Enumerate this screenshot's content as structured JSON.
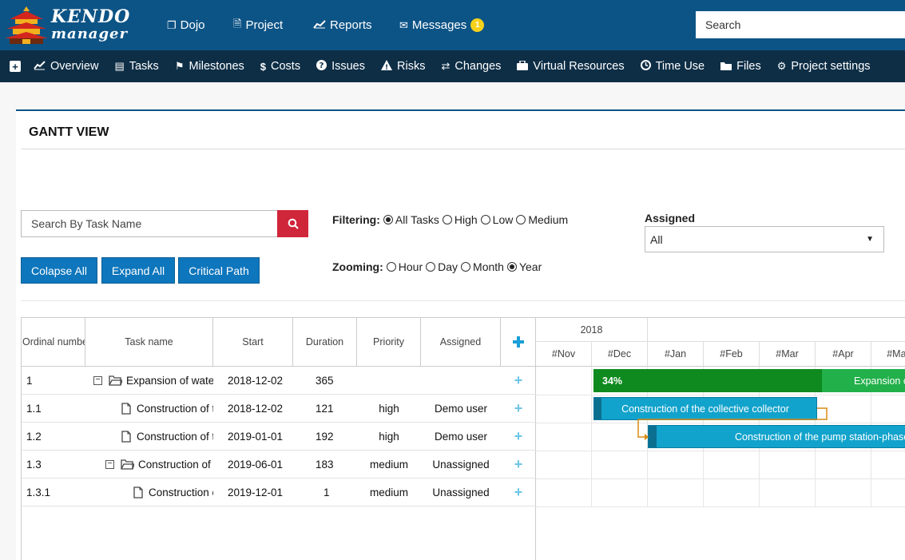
{
  "header": {
    "logo_line1": "KENDO",
    "logo_line2": "manager",
    "nav": [
      {
        "label": "Dojo",
        "icon": "copy-icon"
      },
      {
        "label": "Project",
        "icon": "document-icon"
      },
      {
        "label": "Reports",
        "icon": "line-chart-icon"
      },
      {
        "label": "Messages",
        "icon": "envelope-icon",
        "badge": "1"
      }
    ],
    "search_placeholder": "Search"
  },
  "subnav": [
    {
      "label": "Overview",
      "icon": "area-chart-icon"
    },
    {
      "label": "Tasks",
      "icon": "tasks-icon"
    },
    {
      "label": "Milestones",
      "icon": "flag-icon"
    },
    {
      "label": "Costs",
      "icon": "dollar-icon"
    },
    {
      "label": "Issues",
      "icon": "question-circle-icon"
    },
    {
      "label": "Risks",
      "icon": "warning-icon"
    },
    {
      "label": "Changes",
      "icon": "exchange-icon"
    },
    {
      "label": "Virtual Resources",
      "icon": "briefcase-icon"
    },
    {
      "label": "Time Use",
      "icon": "clock-icon"
    },
    {
      "label": "Files",
      "icon": "folder-icon"
    },
    {
      "label": "Project settings",
      "icon": "cogs-icon"
    }
  ],
  "panel": {
    "title": "GANTT VIEW",
    "task_search_placeholder": "Search By Task Name",
    "buttons": {
      "collapse": "Colapse All",
      "expand": "Expand All",
      "critical": "Critical Path"
    },
    "filtering": {
      "label": "Filtering:",
      "options": [
        "All Tasks",
        "High",
        "Low",
        "Medium"
      ],
      "selected": "All Tasks"
    },
    "zooming": {
      "label": "Zooming:",
      "options": [
        "Hour",
        "Day",
        "Month",
        "Year"
      ],
      "selected": "Year"
    },
    "assigned": {
      "label": "Assigned",
      "value": "All"
    }
  },
  "grid": {
    "headers": [
      "Ordinal number",
      "Task name",
      "Start",
      "Duration",
      "Priority",
      "Assigned"
    ],
    "rows": [
      {
        "ordinal": "1",
        "name": "Expansion of water",
        "start": "2018-12-02",
        "duration": "365",
        "priority": "",
        "assigned": "",
        "type": "folder",
        "level": 0
      },
      {
        "ordinal": "1.1",
        "name": "Construction of the collective collector",
        "start": "2018-12-02",
        "duration": "121",
        "priority": "high",
        "assigned": "Demo user",
        "type": "file",
        "level": 1
      },
      {
        "ordinal": "1.2",
        "name": "Construction of the pump station",
        "start": "2019-01-01",
        "duration": "192",
        "priority": "high",
        "assigned": "Demo user",
        "type": "file",
        "level": 1
      },
      {
        "ordinal": "1.3",
        "name": "Construction of the network",
        "start": "2019-06-01",
        "duration": "183",
        "priority": "medium",
        "assigned": "Unassigned",
        "type": "folder",
        "level": 1
      },
      {
        "ordinal": "1.3.1",
        "name": "Construction of the",
        "start": "2019-12-01",
        "duration": "1",
        "priority": "medium",
        "assigned": "Unassigned",
        "type": "file",
        "level": 2
      }
    ]
  },
  "gantt": {
    "year": "2018",
    "months": [
      "#Nov",
      "#Dec",
      "#Jan",
      "#Feb",
      "#Mar",
      "#Apr",
      "#May"
    ],
    "bars": [
      {
        "label": "Expansion of water supply",
        "progress": "34%",
        "progress_fraction": 0.34,
        "color": "#0f8a1f",
        "color_rest": "#22b04a"
      },
      {
        "label": "Construction of the collective collector",
        "color": "#12a3cc"
      },
      {
        "label": "Construction of the pump station-phase",
        "color": "#12a3cc"
      }
    ],
    "link_color": "#d98b10"
  }
}
